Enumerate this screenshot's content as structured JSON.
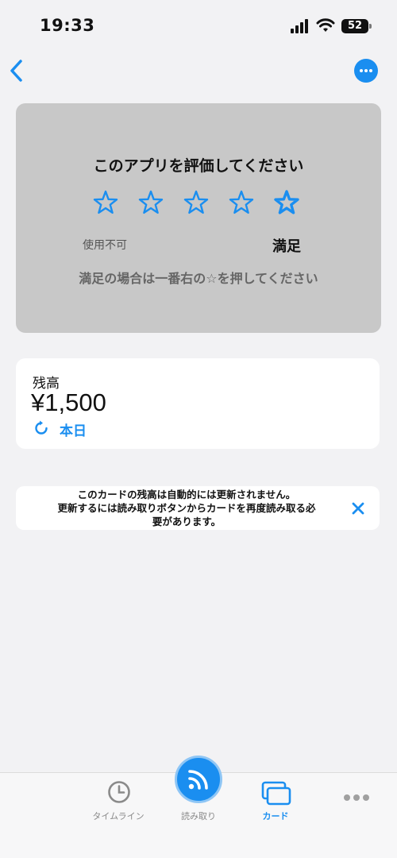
{
  "status_bar": {
    "time": "19:33",
    "battery": "52"
  },
  "rating": {
    "title": "このアプリを評価してください",
    "star_count": 5,
    "low_label": "使用不可",
    "high_label": "満足",
    "hint": "満足の場合は一番右の☆を押してください"
  },
  "balance": {
    "label": "残高",
    "amount": "¥1,500",
    "refresh_label": "本日"
  },
  "notice": {
    "line1": "このカードの残高は自動的には更新されません。",
    "line2": "更新するには読み取りボタンからカードを再度読み取る必",
    "line3": "要があります。"
  },
  "tab_bar": {
    "timeline_label": "タイムライン",
    "read_label": "読み取り",
    "card_label": "カード"
  },
  "colors": {
    "accent": "#1a8ef0",
    "rating_bg": "#c8c8c8",
    "page_bg": "#f2f2f4"
  }
}
